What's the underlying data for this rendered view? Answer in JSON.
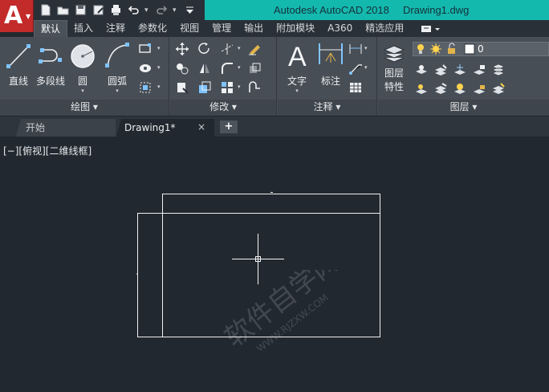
{
  "app": {
    "title": "Autodesk AutoCAD 2018",
    "document": "Drawing1.dwg",
    "logo_letter": "A"
  },
  "ribbon_tabs": [
    "默认",
    "插入",
    "注释",
    "参数化",
    "视图",
    "管理",
    "输出",
    "附加模块",
    "A360",
    "精选应用"
  ],
  "draw_panel": {
    "title": "绘图",
    "line": "直线",
    "polyline": "多段线",
    "circle": "圆",
    "arc": "圆弧"
  },
  "modify_panel": {
    "title": "修改"
  },
  "annotation_panel": {
    "title": "注释",
    "text": "文字",
    "dimension": "标注"
  },
  "layer_panel": {
    "title": "图层",
    "properties_line1": "图层",
    "properties_line2": "特性",
    "current_layer": "0"
  },
  "doc_tabs": {
    "start": "开始",
    "drawing": "Drawing1*",
    "close": "×",
    "new": "+"
  },
  "viewport": {
    "label": "[−][俯视][二维线框]"
  },
  "watermark": {
    "line1": "软件自学网",
    "line2": "WWW.RJZXW.COM"
  },
  "colors": {
    "accent": "#14b9ae",
    "app_red": "#c32a2a",
    "canvas": "#212830",
    "ribbon": "#474e56"
  }
}
